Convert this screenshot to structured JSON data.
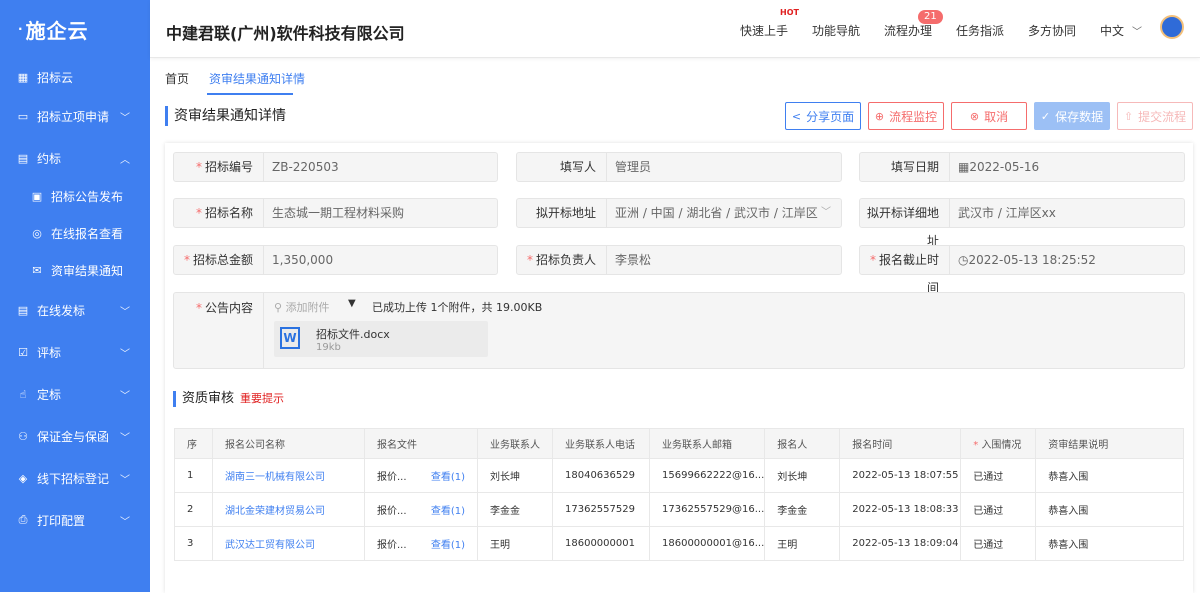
{
  "sidebar": {
    "logo": "施企云",
    "items": [
      {
        "label": "招标云",
        "icon": "grid-icon"
      },
      {
        "label": "招标立项申请",
        "icon": "folder-icon"
      },
      {
        "label": "约标",
        "icon": "docs-icon"
      },
      {
        "label": "招标公告发布",
        "icon": "notice-icon"
      },
      {
        "label": "在线报名查看",
        "icon": "user-icon"
      },
      {
        "label": "资审结果通知",
        "icon": "mail-icon"
      },
      {
        "label": "在线发标",
        "icon": "list-icon"
      },
      {
        "label": "评标",
        "icon": "check-icon"
      },
      {
        "label": "定标",
        "icon": "hand-icon"
      },
      {
        "label": "保证金与保函",
        "icon": "org-icon"
      },
      {
        "label": "线下招标登记",
        "icon": "layers-icon"
      },
      {
        "label": "打印配置",
        "icon": "print-icon"
      }
    ]
  },
  "header": {
    "company": "中建君联(广州)软件科技有限公司",
    "nav": [
      "快速上手",
      "功能导航",
      "流程办理",
      "任务指派",
      "多方协同"
    ],
    "hot": "HOT",
    "badge": "21",
    "lang": "中文"
  },
  "tabs": [
    "首页",
    "资审结果通知详情"
  ],
  "page_title": "资审结果通知详情",
  "buttons": {
    "share": "分享页面",
    "monitor": "流程监控",
    "cancel": "取消",
    "save": "保存数据",
    "submit": "提交流程"
  },
  "form": {
    "bid_no": {
      "label": "招标编号",
      "value": "ZB-220503"
    },
    "writer": {
      "label": "填写人",
      "value": "管理员"
    },
    "date": {
      "label": "填写日期",
      "value": "2022-05-16"
    },
    "bid_name": {
      "label": "招标名称",
      "value": "生态城一期工程材料采购"
    },
    "place": {
      "label": "拟开标地址",
      "value": "亚洲 / 中国 / 湖北省 / 武汉市 / 江岸区"
    },
    "place_detail": {
      "label": "拟开标详细地址",
      "value": "武汉市 / 江岸区xx"
    },
    "amount": {
      "label": "招标总金额",
      "value": "1,350,000"
    },
    "owner": {
      "label": "招标负责人",
      "value": "李景松"
    },
    "deadline": {
      "label": "报名截止时间",
      "value": "2022-05-13 18:25:52"
    },
    "notice": {
      "label": "公告内容",
      "add": "添加附件",
      "status": "已成功上传 1个附件，共 19.00KB",
      "file_name": "招标文件.docx",
      "file_size": "19kb"
    }
  },
  "section": {
    "title": "资质审核",
    "hint": "重要提示"
  },
  "table": {
    "headers": [
      "序",
      "报名公司名称",
      "报名文件",
      "业务联系人",
      "业务联系人电话",
      "业务联系人邮箱",
      "报名人",
      "报名时间",
      "入围情况",
      "资审结果说明"
    ],
    "view_label": "查看(1)",
    "rows": [
      [
        "1",
        "湖南三一机械有限公司",
        "报价...",
        "刘长坤",
        "18040636529",
        "15699662222@16...",
        "刘长坤",
        "2022-05-13 18:07:55",
        "已通过",
        "恭喜入围"
      ],
      [
        "2",
        "湖北金荣建材贸易公司",
        "报价...",
        "李金金",
        "17362557529",
        "17362557529@16...",
        "李金金",
        "2022-05-13 18:08:33",
        "已通过",
        "恭喜入围"
      ],
      [
        "3",
        "武汉达工贸有限公司",
        "报价...",
        "王明",
        "18600000001",
        "18600000001@16...",
        "王明",
        "2022-05-13 18:09:04",
        "已通过",
        "恭喜入围"
      ]
    ]
  },
  "colors": {
    "primary": "#3f7ff0",
    "danger": "#f56c6c",
    "sidebar": "#3f7ff0"
  }
}
